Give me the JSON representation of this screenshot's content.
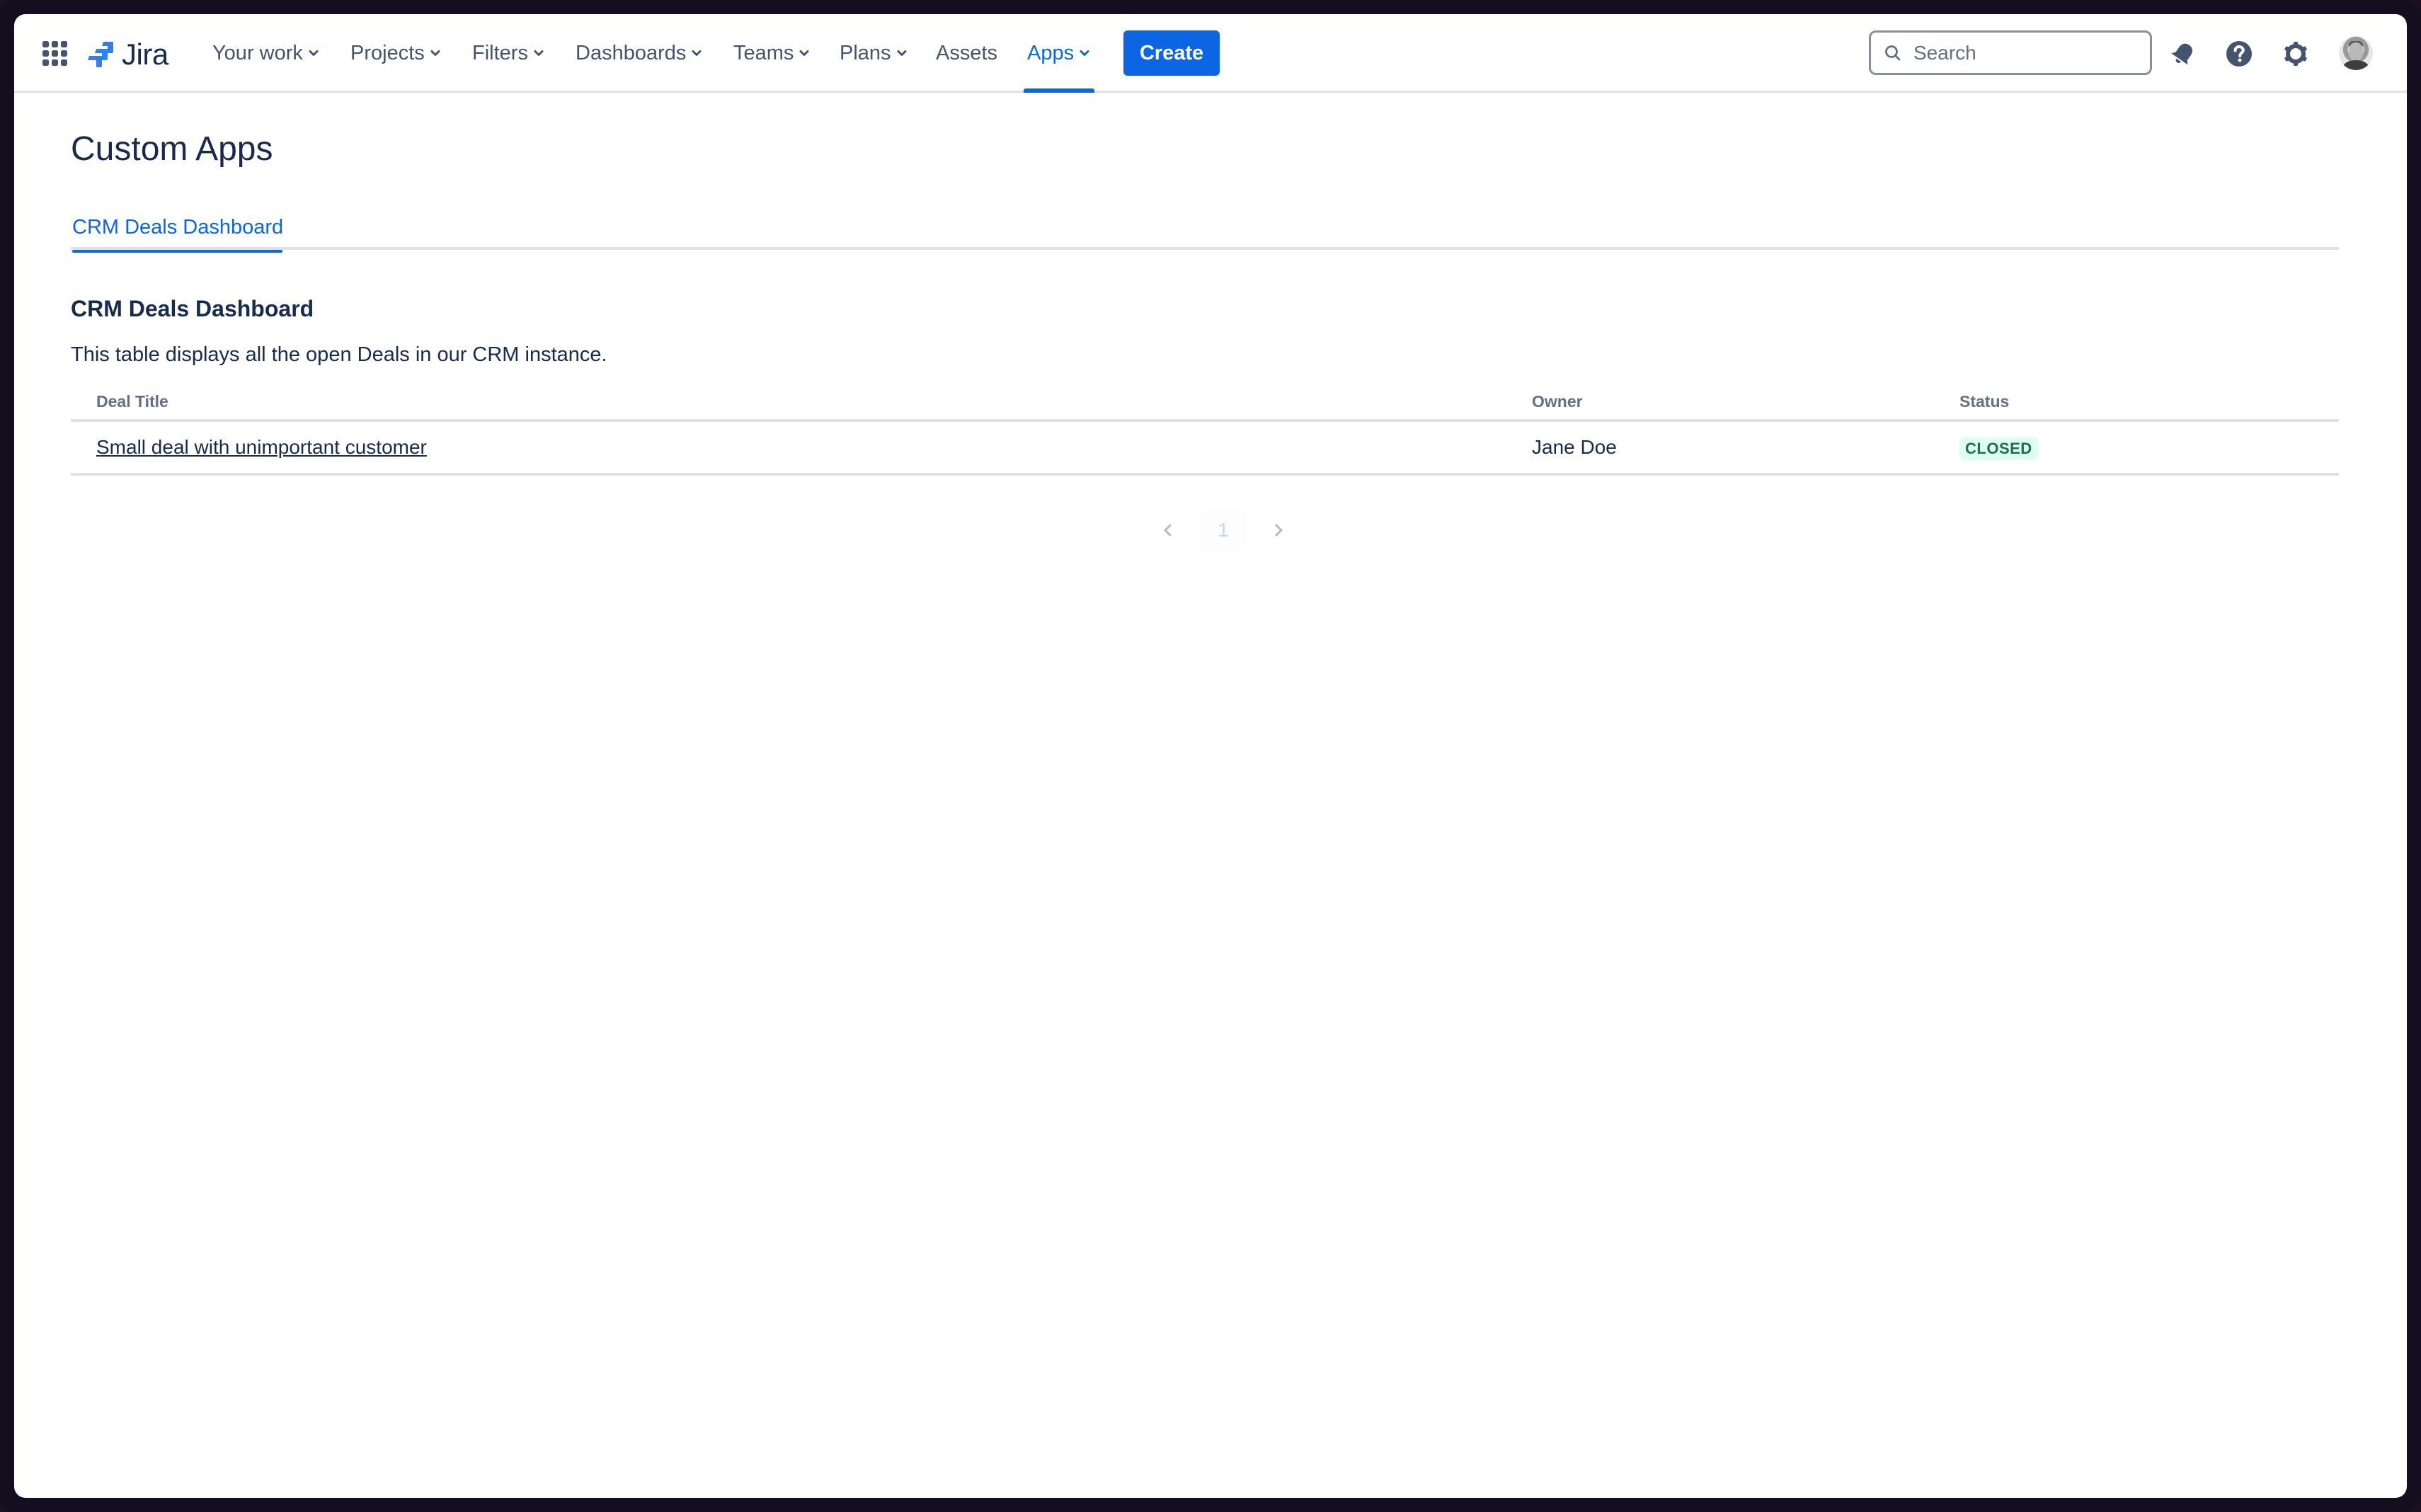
{
  "app": {
    "name": "Jira",
    "brand_color": "#0c66e4"
  },
  "topnav": {
    "apps_switcher_icon": "grid-icon",
    "logo_text": "Jira",
    "items": [
      {
        "label": "Your work",
        "dropdown": true,
        "active": false
      },
      {
        "label": "Projects",
        "dropdown": true,
        "active": false
      },
      {
        "label": "Filters",
        "dropdown": true,
        "active": false
      },
      {
        "label": "Dashboards",
        "dropdown": true,
        "active": false
      },
      {
        "label": "Teams",
        "dropdown": true,
        "active": false
      },
      {
        "label": "Plans",
        "dropdown": true,
        "active": false
      },
      {
        "label": "Assets",
        "dropdown": false,
        "active": false
      },
      {
        "label": "Apps",
        "dropdown": true,
        "active": true
      }
    ],
    "create_label": "Create",
    "search": {
      "placeholder": "Search",
      "value": ""
    },
    "icons": [
      "notifications-bell-icon",
      "help-icon",
      "settings-gear-icon",
      "user-avatar"
    ]
  },
  "page": {
    "title": "Custom Apps",
    "tabs": [
      {
        "label": "CRM Deals Dashboard",
        "active": true
      }
    ]
  },
  "dashboard": {
    "heading": "CRM Deals Dashboard",
    "description": "This table displays all the open Deals in our CRM instance.",
    "table": {
      "columns": [
        "Deal Title",
        "Owner",
        "Status"
      ],
      "rows": [
        {
          "deal_title": "Small deal with unimportant customer",
          "owner": "Jane Doe",
          "status": "CLOSED",
          "status_color": "#216e4e",
          "status_bg": "#dcfff1"
        }
      ]
    },
    "pagination": {
      "current_page": "1",
      "prev_label": "previous-page",
      "next_label": "next-page"
    }
  }
}
